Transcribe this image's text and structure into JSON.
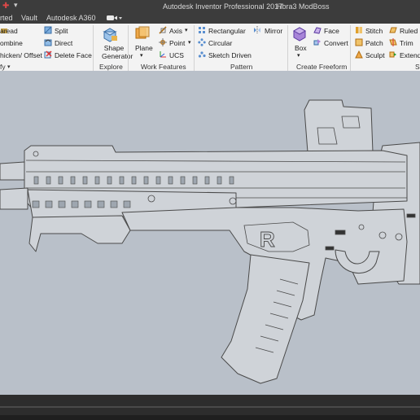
{
  "titlebar": {
    "app_title": "Autodesk Inventor Professional 2017",
    "doc_title": "Hbra3 ModBoss"
  },
  "tabs": [
    "rted",
    "Vault",
    "Autodesk A360"
  ],
  "ribbon": {
    "create_items": [
      "aread",
      "ombine",
      "hicken/ Offset"
    ],
    "modify_items": [
      "Split",
      "Direct",
      "Delete Face"
    ],
    "create_label": "fy",
    "shape_generator": "Shape Generator",
    "explore_label": "Explore",
    "plane": "Plane",
    "axis": "Axis",
    "point": "Point",
    "ucs": "UCS",
    "work_features_label": "Work Features",
    "rectangular": "Rectangular",
    "circular": "Circular",
    "sketch_driven": "Sketch Driven",
    "mirror": "Mirror",
    "pattern_label": "Pattern",
    "box": "Box",
    "face": "Face",
    "convert": "Convert",
    "freeform_label": "Create Freeform",
    "stitch": "Stitch",
    "patch": "Patch",
    "sculpt": "Sculpt",
    "ruled": "Ruled S",
    "trim": "Trim",
    "extend": "Extend",
    "surface_label": "S"
  },
  "model": {
    "grip_letter": "R"
  },
  "colors": {
    "canvas": "#b9c0c9",
    "part_fill": "#cfd3d8",
    "part_stroke": "#4a4a4a",
    "ribbon_bg": "#f3f3f3",
    "titlebar_bg": "#3c3c3c"
  }
}
